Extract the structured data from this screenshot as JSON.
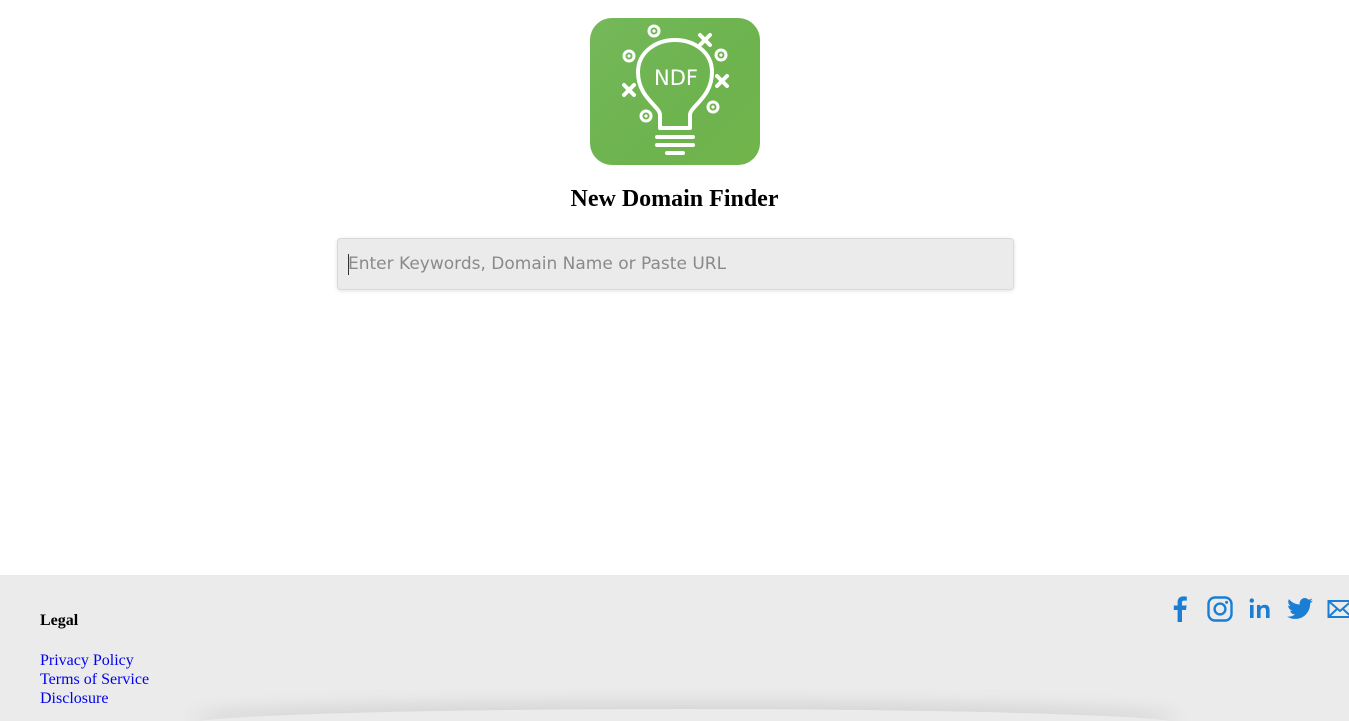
{
  "header": {
    "logo_text": "NDF",
    "title": "New Domain Finder"
  },
  "search": {
    "value": "",
    "placeholder": "Enter Keywords, Domain Name or Paste URL"
  },
  "footer": {
    "legal_heading": "Legal",
    "links": [
      {
        "label": "Privacy Policy"
      },
      {
        "label": "Terms of Service"
      },
      {
        "label": "Disclosure"
      }
    ],
    "social": [
      {
        "icon": "facebook-icon"
      },
      {
        "icon": "instagram-icon"
      },
      {
        "icon": "linkedin-icon"
      },
      {
        "icon": "twitter-icon"
      },
      {
        "icon": "email-icon"
      }
    ]
  },
  "colors": {
    "logo_green": "#6db34e",
    "link_blue": "#0000ee",
    "social_blue": "#1a7fd4",
    "footer_bg": "#ebebeb",
    "input_bg": "#ebebeb"
  }
}
